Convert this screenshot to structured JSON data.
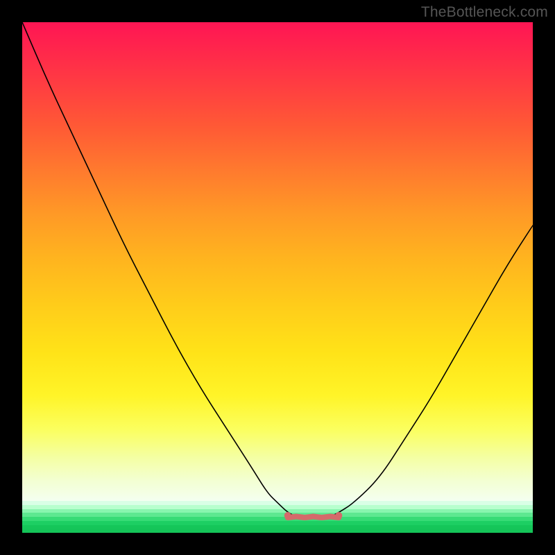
{
  "attribution": "TheBottleneck.com",
  "chart_data": {
    "type": "line",
    "title": "",
    "xlabel": "",
    "ylabel": "",
    "xlim": [
      0,
      100
    ],
    "ylim": [
      0,
      100
    ],
    "x": [
      0,
      5,
      10,
      15,
      20,
      25,
      30,
      35,
      40,
      45,
      48,
      50,
      52,
      54,
      56,
      58,
      60,
      62,
      65,
      70,
      75,
      80,
      85,
      90,
      95,
      100
    ],
    "values": [
      100,
      88,
      77,
      66,
      55,
      45,
      35,
      26,
      18,
      10,
      5,
      3,
      1,
      0,
      0,
      0,
      0,
      1,
      3,
      8,
      16,
      24,
      33,
      42,
      51,
      59
    ],
    "annotations": [
      {
        "text": "bottleneck-minimum-zone",
        "x_range": [
          52,
          62
        ],
        "y": 0
      }
    ],
    "color_scale": {
      "type": "vertical-gradient",
      "stops": [
        {
          "value": 100,
          "color": "#ff1554"
        },
        {
          "value": 60,
          "color": "#ff9a26"
        },
        {
          "value": 30,
          "color": "#ffe318"
        },
        {
          "value": 8,
          "color": "#f4ffa4"
        },
        {
          "value": 0,
          "color": "#1db954"
        }
      ]
    }
  },
  "stripes": {
    "colors": [
      "#d9ffe6",
      "#b7ffce",
      "#88f5af",
      "#5de890",
      "#37db76",
      "#1dcf63",
      "#15c659",
      "#14c458"
    ]
  },
  "marker": {
    "color": "#d46a6a"
  }
}
